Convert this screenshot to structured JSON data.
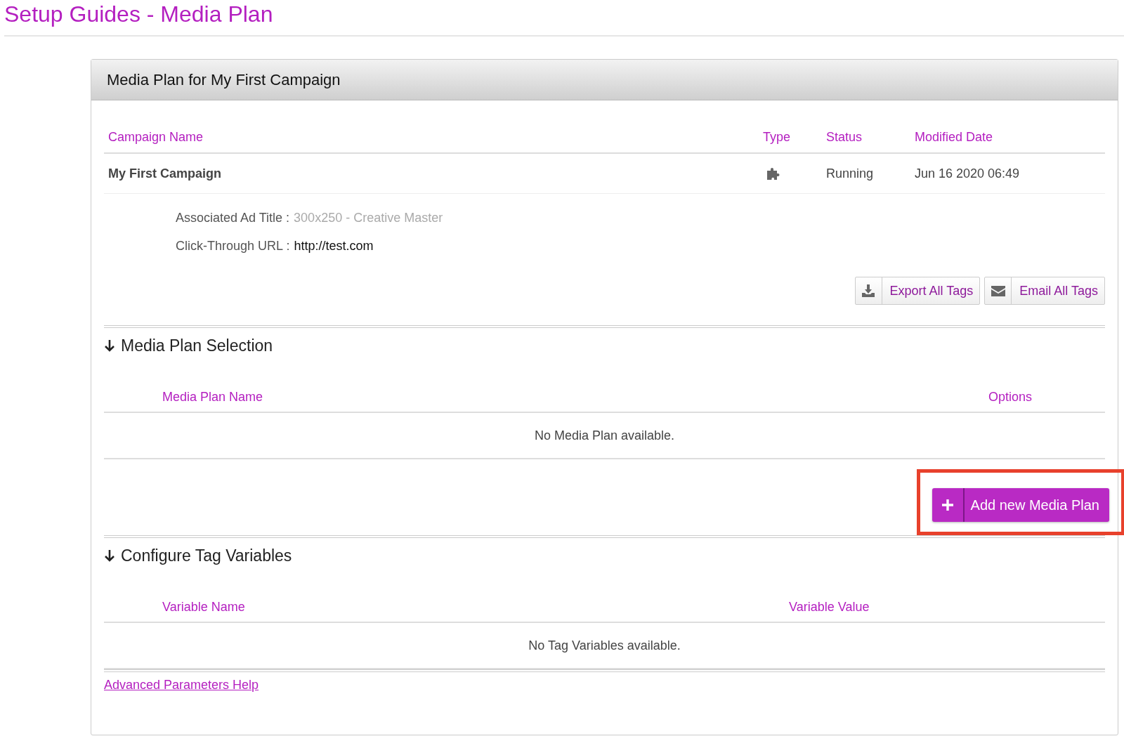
{
  "page_title": "Setup Guides - Media Plan",
  "panel": {
    "title": "Media Plan for My First Campaign"
  },
  "campaign_table": {
    "columns": [
      "Campaign Name",
      "Type",
      "Status",
      "Modified Date"
    ],
    "rows": [
      {
        "name": "My First Campaign",
        "status": "Running",
        "modified": "Jun 16 2020 06:49"
      }
    ]
  },
  "details": [
    {
      "label": "Associated Ad Title :",
      "value": "300x250 - Creative Master",
      "kind": "muted"
    },
    {
      "label": "Click-Through URL :",
      "value": "http://test.com",
      "kind": "plain"
    }
  ],
  "tag_buttons": [
    {
      "label": "Export All Tags"
    },
    {
      "label": "Email All Tags"
    }
  ],
  "media_plan_section": {
    "heading": "Media Plan Selection",
    "columns": [
      "Media Plan Name",
      "Options"
    ],
    "empty_text": "No Media Plan available.",
    "add_button": {
      "label": "Add new Media Plan",
      "highlighted": true
    }
  },
  "tag_variables_section": {
    "heading": "Configure Tag Variables",
    "columns": [
      "Variable Name",
      "Variable Value"
    ],
    "empty_text": "No Tag Variables available."
  },
  "help_link": "Advanced Parameters Help"
}
